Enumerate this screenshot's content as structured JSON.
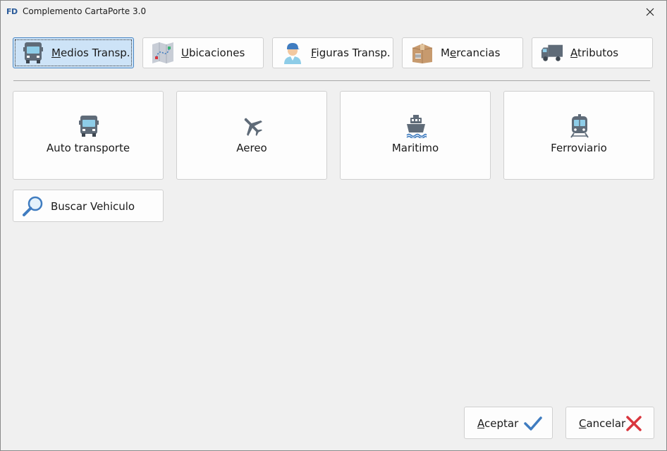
{
  "window": {
    "app_icon_text": "FD",
    "title": "Complemento CartaPorte 3.0"
  },
  "tabs": [
    {
      "mnemonic": "M",
      "rest": "edios Transp.",
      "icon": "truck-icon",
      "active": true
    },
    {
      "mnemonic": "U",
      "rest": "bicaciones",
      "icon": "map-icon",
      "active": false
    },
    {
      "mnemonic": "F",
      "rest": "iguras Transp.",
      "icon": "person-icon",
      "active": false
    },
    {
      "pre": "M",
      "mnemonic": "e",
      "rest": "rcancias",
      "icon": "package-icon",
      "active": false
    },
    {
      "mnemonic": "A",
      "rest": "tributos",
      "icon": "delivery-truck-icon",
      "active": false
    }
  ],
  "transport_modes": [
    {
      "label": "Auto transporte",
      "icon": "bus-icon"
    },
    {
      "label": "Aereo",
      "icon": "airplane-icon"
    },
    {
      "label": "Maritimo",
      "icon": "ship-icon"
    },
    {
      "label": "Ferroviario",
      "icon": "train-icon"
    }
  ],
  "search_button": {
    "label": "Buscar Vehiculo",
    "icon": "magnifier-icon"
  },
  "buttons": {
    "accept": {
      "mnemonic": "A",
      "rest": "ceptar",
      "icon": "checkmark-icon"
    },
    "cancel": {
      "mnemonic": "C",
      "rest": "ancelar",
      "icon": "x-icon"
    }
  },
  "colors": {
    "active_tab_bg": "#cde3f7",
    "accent_blue": "#3f7cc0",
    "cancel_red": "#d9363e",
    "icon_gray": "#5f6b78"
  }
}
